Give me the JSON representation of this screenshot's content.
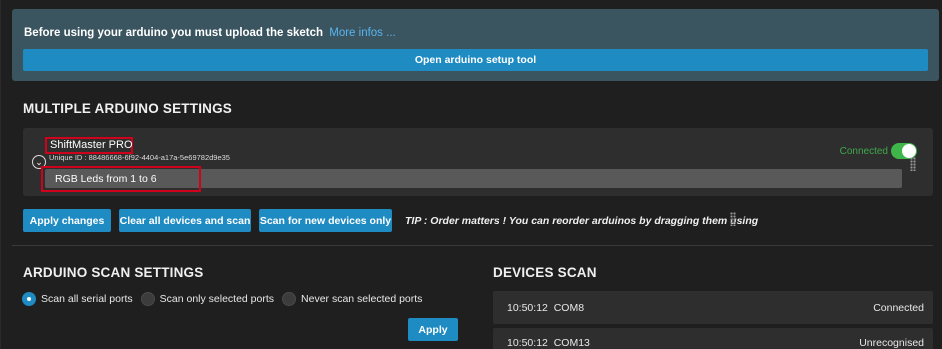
{
  "notice": {
    "text": "Before using your arduino you must upload the sketch",
    "link": "More infos ...",
    "setup_button": "Open arduino setup tool"
  },
  "multiple_settings": {
    "title": "MULTIPLE ARDUINO SETTINGS",
    "device": {
      "name": "ShiftMaster PRO",
      "unique_id": "Unique ID : 88486668-6f92-4404-a17a-5e69782d9e35",
      "description": "RGB Leds from 1 to 6",
      "status": "Connected",
      "toggle_on": true
    },
    "buttons": {
      "apply": "Apply changes",
      "clear": "Clear all devices and scan",
      "scan_new": "Scan for new devices only"
    },
    "tip": "TIP : Order matters ! You can reorder arduinos by dragging them using"
  },
  "scan_settings": {
    "title": "ARDUINO SCAN SETTINGS",
    "options": [
      {
        "label": "Scan all serial ports",
        "selected": true
      },
      {
        "label": "Scan only selected ports",
        "selected": false
      },
      {
        "label": "Never scan selected ports",
        "selected": false
      }
    ],
    "apply": "Apply"
  },
  "devices_scan": {
    "title": "DEVICES SCAN",
    "rows": [
      {
        "time": "10:50:12",
        "port": "COM8",
        "status": "Connected"
      },
      {
        "time": "10:50:12",
        "port": "COM13",
        "status": "Unrecognised"
      }
    ]
  },
  "colors": {
    "accent": "#1e8bc3",
    "connected": "#3fb64a",
    "highlight": "#d0021b"
  }
}
